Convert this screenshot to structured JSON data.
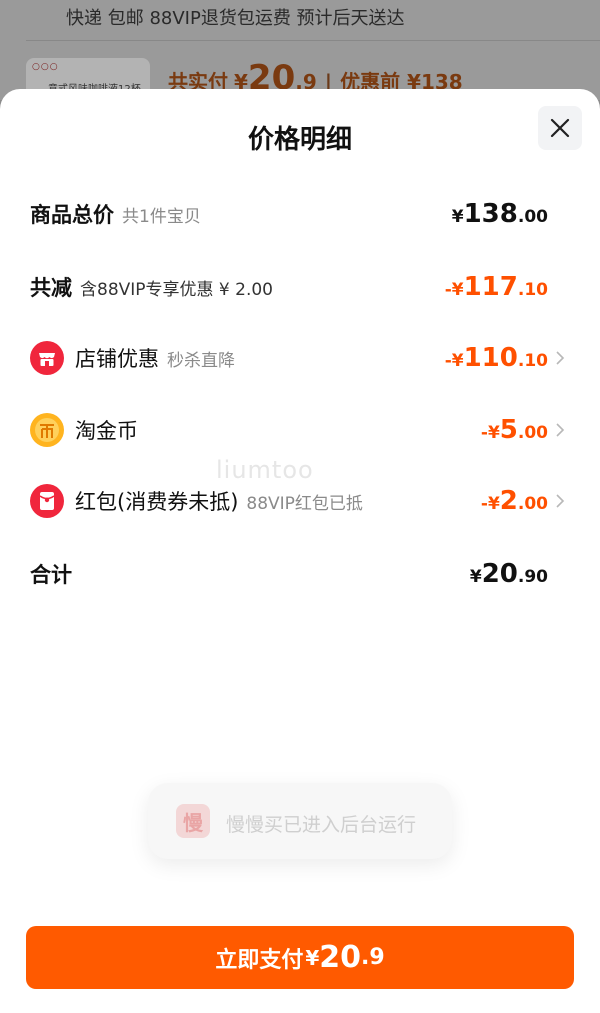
{
  "background": {
    "delivery_line": "快递 包邮 88VIP退货包运费 预计后天送达",
    "thumb_dots": "○○○",
    "thumb_caption": "意式风味咖啡液12杯",
    "price_label": "共实付",
    "price_currency": "¥",
    "price_int": "20",
    "price_dec": ".9",
    "separator": "|",
    "original_price": "优惠前 ¥138"
  },
  "sheet": {
    "title": "价格明细",
    "close_icon": "close-icon"
  },
  "rows": {
    "total": {
      "label": "商品总价",
      "sub": "共1件宝贝",
      "currency": "¥",
      "int": "138",
      "dec": ".00"
    },
    "reduction": {
      "label": "共减",
      "sub": "含88VIP专享优惠 ¥ 2.00",
      "currency": "-¥",
      "int": "117",
      "dec": ".10"
    },
    "shop": {
      "icon": "shop-icon",
      "label": "店铺优惠",
      "sub": "秒杀直降",
      "currency": "-¥",
      "int": "110",
      "dec": ".10"
    },
    "coin": {
      "icon": "coin-icon",
      "label": "淘金币",
      "currency": "-¥",
      "int": "5",
      "dec": ".00"
    },
    "redpacket": {
      "icon": "red-packet-icon",
      "label": "红包(消费券未抵)",
      "sub": "88VIP红包已抵",
      "currency": "-¥",
      "int": "2",
      "dec": ".00"
    },
    "sum": {
      "label": "合计",
      "currency": "¥",
      "int": "20",
      "dec": ".90"
    }
  },
  "watermark": "liumtoo",
  "toast": {
    "icon_char": "慢",
    "text": "慢慢买已进入后台运行"
  },
  "pay_button": {
    "label": "立即支付",
    "currency": "¥",
    "int": "20",
    "dec": ".9"
  },
  "colors": {
    "accent": "#ff5a00",
    "discount": "#ff5000"
  }
}
